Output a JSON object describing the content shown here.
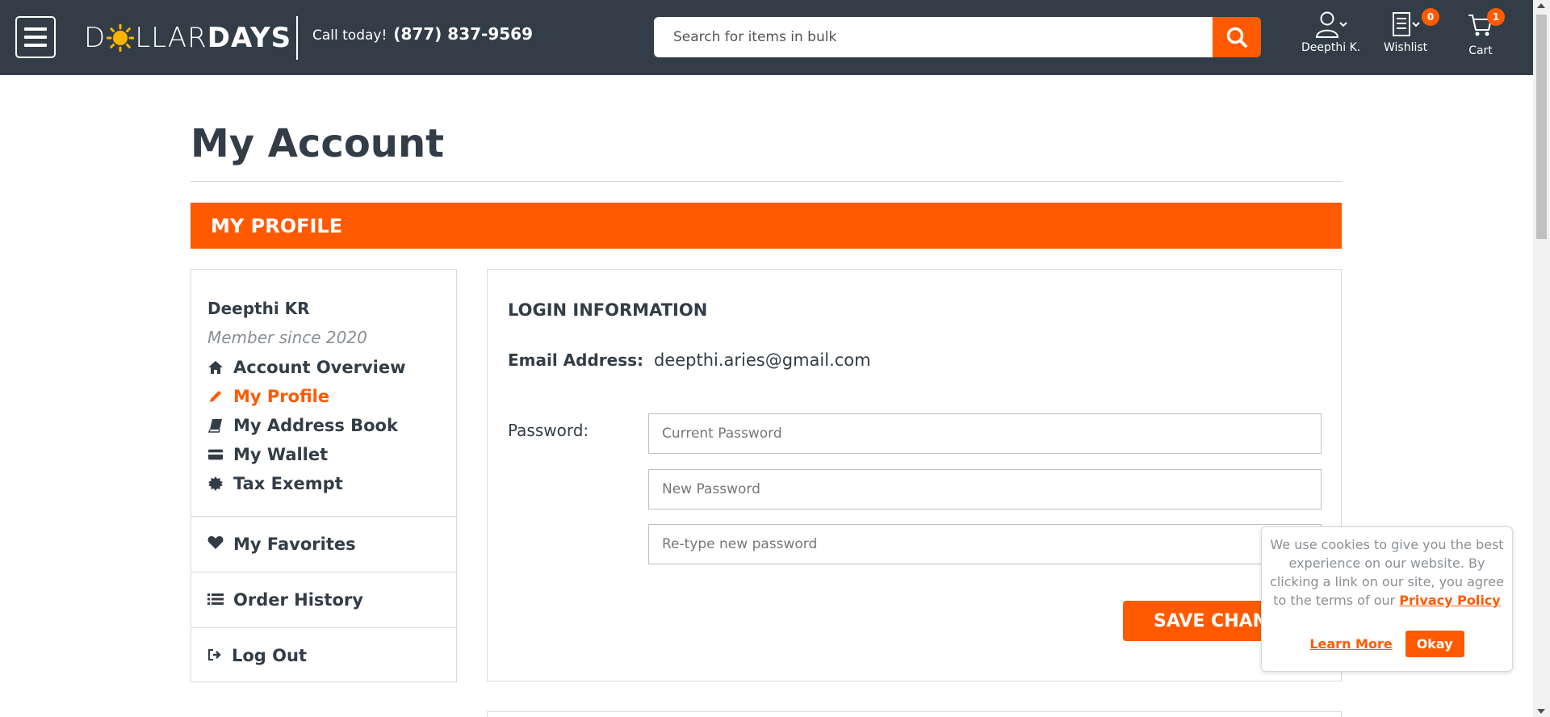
{
  "header": {
    "logo_left": "DOLLAR",
    "logo_right": "DAYS",
    "call_label": "Call today!",
    "phone": "(877) 837-9569",
    "search_placeholder": "Search for items in bulk",
    "account_label": "Deepthi K.",
    "wishlist_label": "Wishlist",
    "wishlist_count": "0",
    "cart_label": "Cart",
    "cart_count": "1"
  },
  "page": {
    "title": "My Account",
    "section": "MY PROFILE"
  },
  "sidebar": {
    "name": "Deepthi KR",
    "member_since": "Member since 2020",
    "links": [
      {
        "label": "Account Overview",
        "icon": "home-icon"
      },
      {
        "label": "My Profile",
        "icon": "pencil-icon",
        "active": true
      },
      {
        "label": "My Address Book",
        "icon": "book-icon"
      },
      {
        "label": "My Wallet",
        "icon": "credit-card-icon"
      },
      {
        "label": "Tax Exempt",
        "icon": "certificate-icon"
      }
    ],
    "sections": [
      {
        "label": "My Favorites",
        "icon": "heart-icon"
      },
      {
        "label": "Order History",
        "icon": "list-icon"
      },
      {
        "label": "Log Out",
        "icon": "sign-out-icon"
      }
    ]
  },
  "login": {
    "title": "LOGIN INFORMATION",
    "email_label": "Email Address:",
    "email_value": "deepthi.aries@gmail.com",
    "password_label": "Password:",
    "current_placeholder": "Current Password",
    "new_placeholder": "New Password",
    "retype_placeholder": "Re-type new password",
    "save_label": "SAVE CHANGES"
  },
  "cookie": {
    "text": "We use cookies to give you the best experience on our website. By clicking a link on our site, you agree to the terms of our",
    "policy_link": "Privacy Policy",
    "learn_more": "Learn More",
    "okay": "Okay"
  },
  "colors": {
    "header_bg": "#333d47",
    "accent": "#ff5a00",
    "text": "#333d47",
    "muted": "#8a8f94"
  }
}
